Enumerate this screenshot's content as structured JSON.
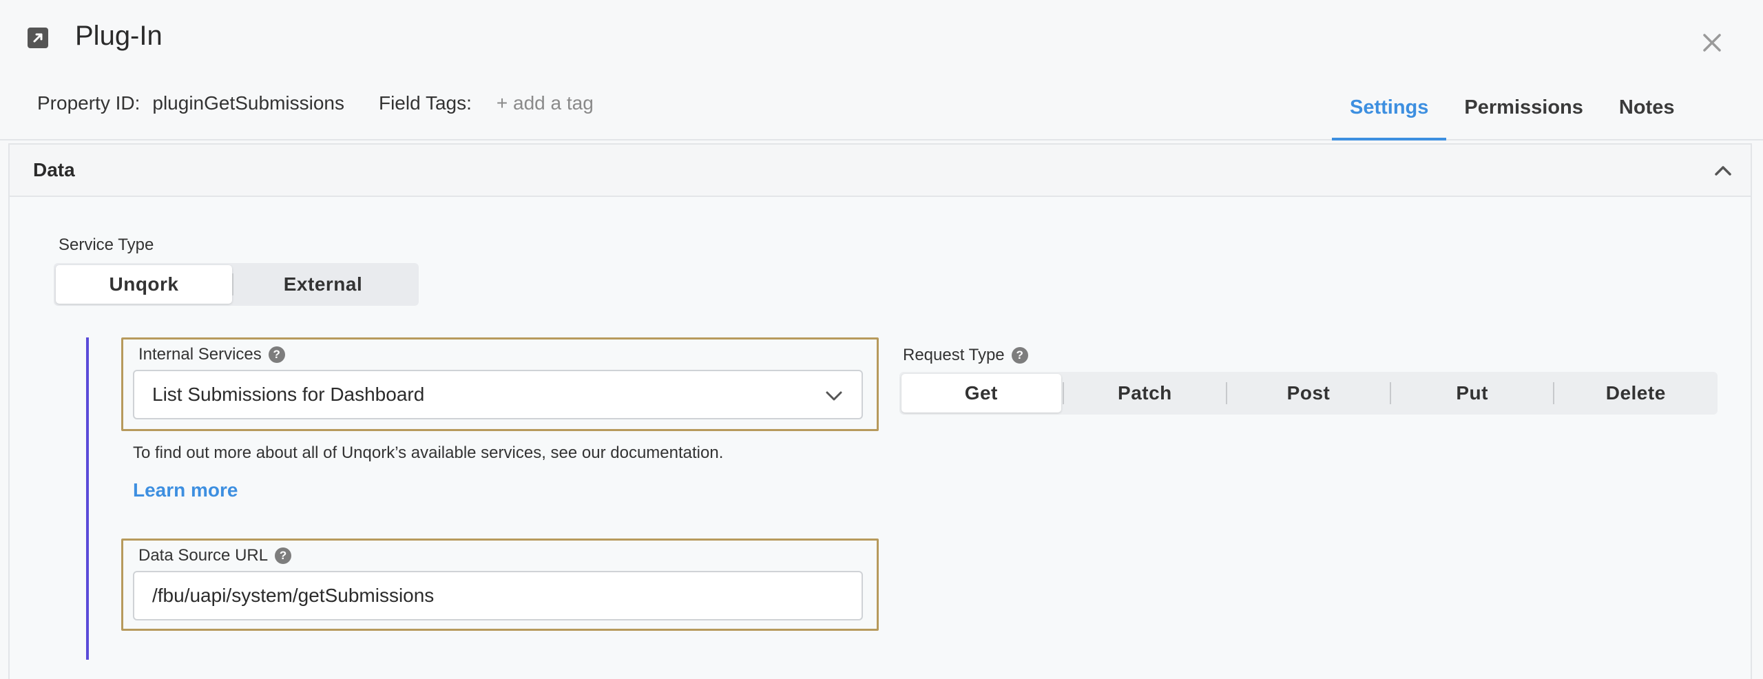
{
  "header": {
    "title": "Plug-In",
    "icon": "external-link-icon",
    "close_icon": "close-icon"
  },
  "meta": {
    "property_id_label": "Property ID:",
    "property_id_value": "pluginGetSubmissions",
    "field_tags_label": "Field Tags:",
    "add_tag_placeholder": "+ add a tag"
  },
  "tabs": [
    {
      "label": "Settings",
      "active": true
    },
    {
      "label": "Permissions",
      "active": false
    },
    {
      "label": "Notes",
      "active": false
    }
  ],
  "panel": {
    "title": "Data",
    "collapse_icon": "chevron-up-icon"
  },
  "service_type": {
    "label": "Service Type",
    "options": [
      "Unqork",
      "External"
    ],
    "selected": "Unqork"
  },
  "internal_services": {
    "label": "Internal Services",
    "selected_value": "List Submissions for Dashboard",
    "help_icon": "question-circle-icon",
    "dropdown_icon": "chevron-down-icon"
  },
  "help_text": "To find out more about all of Unqork’s available services, see our documentation.",
  "learn_more": "Learn more",
  "request_type": {
    "label": "Request Type",
    "options": [
      "Get",
      "Patch",
      "Post",
      "Put",
      "Delete"
    ],
    "selected": "Get"
  },
  "data_source_url": {
    "label": "Data Source URL",
    "value": "/fbu/uapi/system/getSubmissions"
  },
  "colors": {
    "accent_blue": "#3d8fe0",
    "highlight_gold": "#b79a5c",
    "accent_purple": "#5a4bd8"
  }
}
